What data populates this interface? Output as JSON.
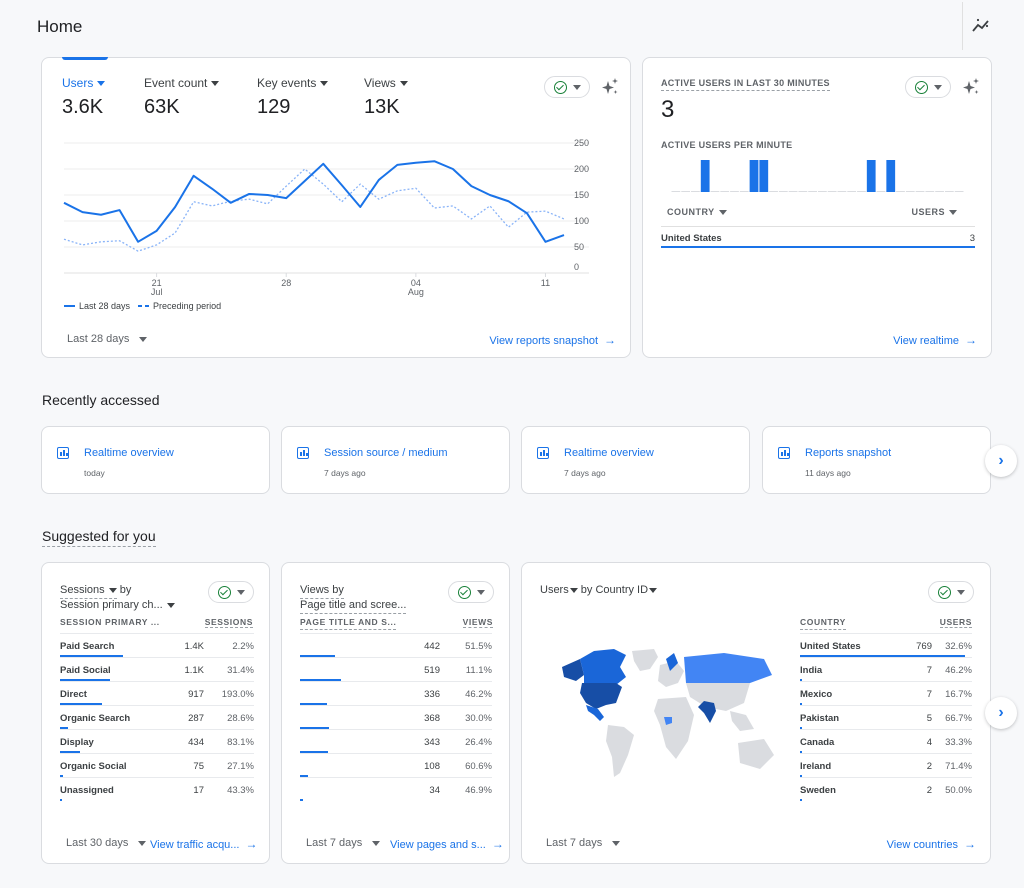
{
  "header": {
    "title": "Home",
    "insights_icon": "insights-icon"
  },
  "overview": {
    "metrics": [
      {
        "label": "Users",
        "value": "3.6K",
        "active": true
      },
      {
        "label": "Event count",
        "value": "63K",
        "active": false
      },
      {
        "label": "Key events",
        "value": "129",
        "active": false
      },
      {
        "label": "Views",
        "value": "13K",
        "active": false
      }
    ],
    "date_range": "Last 28 days",
    "link": "View reports snapshot"
  },
  "chart_data": {
    "type": "line",
    "title": "Users",
    "x_ticks": [
      {
        "index": 5,
        "label": "21",
        "sub": "Jul"
      },
      {
        "index": 12,
        "label": "28",
        "sub": ""
      },
      {
        "index": 19,
        "label": "04",
        "sub": "Aug"
      },
      {
        "index": 26,
        "label": "11",
        "sub": ""
      }
    ],
    "y_ticks": [
      "250",
      "200",
      "150",
      "100",
      "50",
      "0"
    ],
    "ylim": [
      0,
      250
    ],
    "grid": true,
    "legend_position": "bottom-left",
    "series": [
      {
        "name": "Last 28 days",
        "style": "solid",
        "values": [
          135,
          117,
          112,
          121,
          60,
          81,
          127,
          187,
          162,
          135,
          152,
          150,
          144,
          177,
          210,
          169,
          127,
          179,
          208,
          212,
          215,
          200,
          167,
          150,
          138,
          115,
          60,
          73
        ]
      },
      {
        "name": "Preceding period",
        "style": "dashed",
        "values": [
          65,
          54,
          60,
          62,
          42,
          54,
          77,
          137,
          129,
          138,
          142,
          133,
          167,
          200,
          171,
          137,
          171,
          142,
          158,
          163,
          125,
          129,
          104,
          129,
          88,
          117,
          119,
          104
        ]
      }
    ]
  },
  "realtime": {
    "title": "ACTIVE USERS IN LAST 30 MINUTES",
    "value": "3",
    "subtitle": "ACTIVE USERS PER MINUTE",
    "per_minute": [
      0,
      0,
      0,
      1,
      0,
      0,
      0,
      0,
      1,
      1,
      0,
      0,
      0,
      0,
      0,
      0,
      0,
      0,
      0,
      0,
      1,
      0,
      1,
      0,
      0,
      0,
      0,
      0,
      0,
      0
    ],
    "col_country": "COUNTRY",
    "col_users": "USERS",
    "rows": [
      {
        "country": "United States",
        "users": "3"
      }
    ],
    "link": "View realtime"
  },
  "recent": {
    "title": "Recently accessed",
    "items": [
      {
        "title": "Realtime overview",
        "when": "today"
      },
      {
        "title": "Session source / medium",
        "when": "7 days ago"
      },
      {
        "title": "Realtime overview",
        "when": "7 days ago"
      },
      {
        "title": "Reports snapshot",
        "when": "11 days ago"
      }
    ]
  },
  "suggested": {
    "title": "Suggested for you",
    "sessions": {
      "title_line1": "Sessions",
      "title_by": "by",
      "title_line2": "Session primary ch...",
      "col1": "SESSION PRIMARY ...",
      "col2": "SESSIONS",
      "rows": [
        {
          "label": "Paid Search",
          "value": "1.4K",
          "pct": "2.2%",
          "share": 1.0
        },
        {
          "label": "Paid Social",
          "value": "1.1K",
          "pct": "31.4%",
          "share": 0.79
        },
        {
          "label": "Direct",
          "value": "917",
          "pct": "193.0%",
          "share": 0.66
        },
        {
          "label": "Organic Search",
          "value": "287",
          "pct": "28.6%",
          "share": 0.12
        },
        {
          "label": "Display",
          "value": "434",
          "pct": "83.1%",
          "share": 0.31
        },
        {
          "label": "Organic Social",
          "value": "75",
          "pct": "27.1%",
          "share": 0.05
        },
        {
          "label": "Unassigned",
          "value": "17",
          "pct": "43.3%",
          "share": 0.01
        }
      ],
      "date_range": "Last 30 days",
      "link": "View traffic acqu..."
    },
    "views": {
      "title_line1": "Views by",
      "title_line2": "Page title and scree...",
      "col1": "PAGE TITLE AND S...",
      "col2": "VIEWS",
      "rows": [
        {
          "label": "",
          "value": "442",
          "pct": "51.5%",
          "share": 0.55
        },
        {
          "label": "",
          "value": "519",
          "pct": "11.1%",
          "share": 0.64
        },
        {
          "label": "",
          "value": "336",
          "pct": "46.2%",
          "share": 0.42
        },
        {
          "label": "",
          "value": "368",
          "pct": "30.0%",
          "share": 0.46
        },
        {
          "label": "",
          "value": "343",
          "pct": "26.4%",
          "share": 0.43
        },
        {
          "label": "",
          "value": "108",
          "pct": "60.6%",
          "share": 0.13
        },
        {
          "label": "",
          "value": "34",
          "pct": "46.9%",
          "share": 0.04
        }
      ],
      "date_range": "Last 7 days",
      "link": "View pages and s..."
    },
    "countries": {
      "title": "Users",
      "title_by": "by Country ID",
      "col1": "COUNTRY",
      "col2": "USERS",
      "rows": [
        {
          "label": "United States",
          "value": "769",
          "pct": "32.6%",
          "share": 1.0
        },
        {
          "label": "India",
          "value": "7",
          "pct": "46.2%",
          "share": 0.01
        },
        {
          "label": "Mexico",
          "value": "7",
          "pct": "16.7%",
          "share": 0.01
        },
        {
          "label": "Pakistan",
          "value": "5",
          "pct": "66.7%",
          "share": 0.01
        },
        {
          "label": "Canada",
          "value": "4",
          "pct": "33.3%",
          "share": 0.01
        },
        {
          "label": "Ireland",
          "value": "2",
          "pct": "71.4%",
          "share": 0.005
        },
        {
          "label": "Sweden",
          "value": "2",
          "pct": "50.0%",
          "share": 0.005
        }
      ],
      "date_range": "Last 7 days",
      "link": "View countries"
    }
  },
  "colors": {
    "accent": "#1a73e8",
    "dashed": "#8ab4f8",
    "map_dark": "#174ea6",
    "map_mid": "#1a66d8",
    "map_light": "#4285f4",
    "map_none": "#dadce0",
    "check": "#188038"
  }
}
